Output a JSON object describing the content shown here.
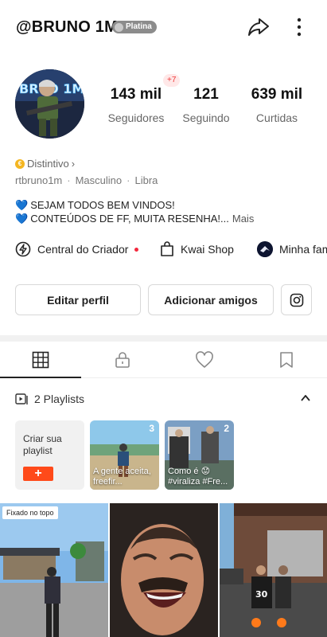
{
  "header": {
    "username": "@BRUNO 1M",
    "badge": "Platina",
    "share_icon": "share-arrow-icon",
    "more_icon": "more-vertical-icon"
  },
  "stats": {
    "followers_value": "143 mil",
    "followers_label": "Seguidores",
    "followers_new": "+7",
    "following_value": "121",
    "following_label": "Seguindo",
    "likes_value": "639 mil",
    "likes_label": "Curtidas"
  },
  "profile": {
    "distintivo": "Distintivo",
    "handle": "rtbruno1m",
    "gender": "Masculino",
    "zodiac": "Libra",
    "bio_line1": "SEJAM TODOS BEM VINDOS!",
    "bio_line2": "CONTEÚDOS DE FF, MUITA RESENHA!...",
    "bio_more": "Mais"
  },
  "quick_links": {
    "creator": "Central do Criador",
    "shop": "Kwai Shop",
    "family": "Minha família"
  },
  "actions": {
    "edit": "Editar perfil",
    "add_friends": "Adicionar amigos"
  },
  "tabs": [
    "grid",
    "private",
    "liked",
    "saved"
  ],
  "playlists": {
    "title": "2 Playlists",
    "create_label": "Criar sua playlist",
    "create_button": "+",
    "items": [
      {
        "count": "3",
        "caption": "A gente aceita, freefir..."
      },
      {
        "count": "2",
        "caption": "Como é 😟 #viraliza #Fre..."
      }
    ]
  },
  "videos": {
    "pinned_label": "Fixado no topo"
  },
  "colors": {
    "accent": "#ff4a1a",
    "badge_red": "#ef3a3a",
    "heart_blue": "#2f7be6"
  }
}
